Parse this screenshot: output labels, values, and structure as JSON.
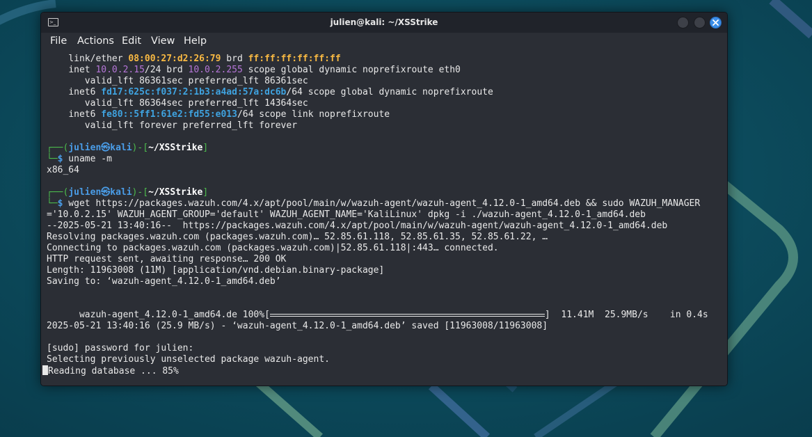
{
  "window": {
    "title": "julien@kali: ~/XSStrike",
    "icon": "terminal-icon",
    "accent": "#3b8ee8"
  },
  "menu": [
    "File",
    "Actions",
    "Edit",
    "View",
    "Help"
  ],
  "terminal": {
    "ifconfig": {
      "ether_prefix": "link/ether ",
      "mac": "08:00:27:d2:26:79",
      "brd": " brd ",
      "mac_brd": "ff:ff:ff:ff:ff:ff",
      "inet_prefix": "inet ",
      "ip": "10.0.2.15",
      "inet_mid": "/24 brd ",
      "ip_brd": "10.0.2.255",
      "inet_suffix": " scope global dynamic noprefixroute eth0",
      "valid1": "valid_lft 86361sec preferred_lft 86361sec",
      "inet6_prefix": "inet6 ",
      "ip6": "fd17:625c:f037:2:1b3:a4ad:57a:dc6b",
      "inet6_suffix": "/64 scope global dynamic noprefixroute",
      "valid2": "valid_lft 86364sec preferred_lft 14364sec",
      "ip6_link": "fe80::5ff1:61e2:fd55:e013",
      "inet6_link_suffix": "/64 scope link noprefixroute",
      "valid3": "valid_lft forever preferred_lft forever"
    },
    "prompt": {
      "top_open": "┌──(",
      "user_host": "julien㉿kali",
      "top_mid": ")-[",
      "cwd": "~/XSStrike",
      "top_close": "]",
      "bottom": "└─",
      "symbol": "$"
    },
    "cmd1": " uname -m",
    "out1": "x86_64",
    "cmd2": " wget https://packages.wazuh.com/4.x/apt/pool/main/w/wazuh-agent/wazuh-agent_4.12.0-1_amd64.deb && sudo WAZUH_MANAGER",
    "cmd2_cont": "='10.0.2.15' WAZUH_AGENT_GROUP='default' WAZUH_AGENT_NAME='KaliLinux' dpkg -i ./wazuh-agent_4.12.0-1_amd64.deb",
    "wget_lines": [
      "--2025-05-21 13:40:16--  https://packages.wazuh.com/4.x/apt/pool/main/w/wazuh-agent/wazuh-agent_4.12.0-1_amd64.deb",
      "Resolving packages.wazuh.com (packages.wazuh.com)… 52.85.61.118, 52.85.61.35, 52.85.61.22, …",
      "Connecting to packages.wazuh.com (packages.wazuh.com)|52.85.61.118|:443… connected.",
      "HTTP request sent, awaiting response… 200 OK",
      "Length: 11963008 (11M) [application/vnd.debian.binary-package]",
      "Saving to: ‘wazuh-agent_4.12.0-1_amd64.deb’"
    ],
    "progress": {
      "prefix": "wazuh-agent_4.12.0-1_amd64.de 100%[",
      "suffix": "]  11.41M  25.9MB/s    in 0.4s",
      "fraction": 1.0
    },
    "saved_line": "2025-05-21 13:40:16 (25.9 MB/s) - ‘wazuh-agent_4.12.0-1_amd64.deb’ saved [11963008/11963008]",
    "sudo_line": "[sudo] password for julien:",
    "select_line": "Selecting previously unselected package wazuh-agent.",
    "reading_line": "Reading database ... 85%"
  }
}
